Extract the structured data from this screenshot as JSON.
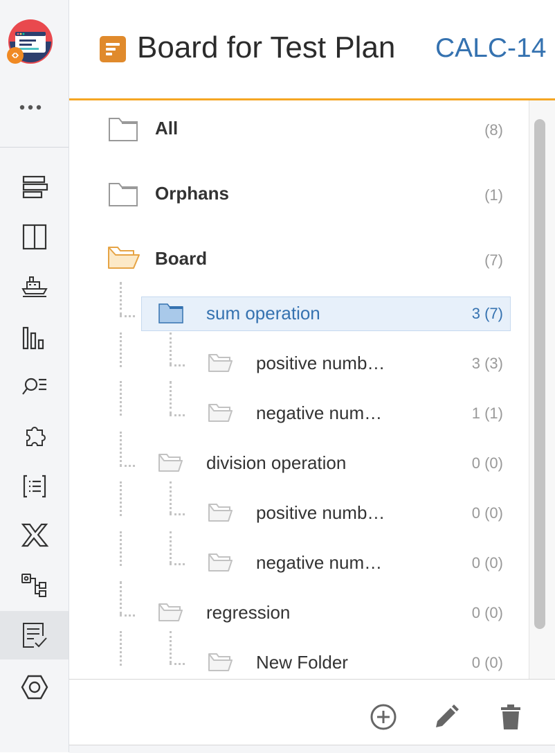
{
  "header": {
    "title": "Board for Test Plan",
    "issue_key": "CALC-14",
    "icon": "test-plan-icon",
    "accent_color": "#f5a623"
  },
  "rail": {
    "logo": "app-logo",
    "more_icon": "more-icon",
    "items": [
      {
        "icon": "boards-icon"
      },
      {
        "icon": "columns-icon"
      },
      {
        "icon": "ship-icon"
      },
      {
        "icon": "reports-icon"
      },
      {
        "icon": "search-list-icon"
      },
      {
        "icon": "puzzle-icon"
      },
      {
        "icon": "list-brackets-icon"
      },
      {
        "icon": "xray-icon"
      },
      {
        "icon": "tree-structure-icon"
      },
      {
        "icon": "test-plan-checklist-icon",
        "active": true
      },
      {
        "icon": "settings-hexagon-icon"
      }
    ]
  },
  "tree": {
    "items": [
      {
        "label": "All",
        "count": "(8)"
      },
      {
        "label": "Orphans",
        "count": "(1)"
      },
      {
        "label": "Board",
        "count": "(7)"
      },
      {
        "label": "sum operation",
        "count": "3 (7)",
        "selected": true
      },
      {
        "label": "positive numb…",
        "count": "3 (3)"
      },
      {
        "label": "negative num…",
        "count": "1 (1)"
      },
      {
        "label": "division operation",
        "count": "0 (0)"
      },
      {
        "label": "positive numb…",
        "count": "0 (0)"
      },
      {
        "label": "negative num…",
        "count": "0 (0)"
      },
      {
        "label": "regression",
        "count": "0 (0)"
      },
      {
        "label": "New Folder",
        "count": "0 (0)"
      }
    ]
  },
  "footer": {
    "actions": [
      "add-folder-icon",
      "edit-icon",
      "delete-icon"
    ]
  }
}
